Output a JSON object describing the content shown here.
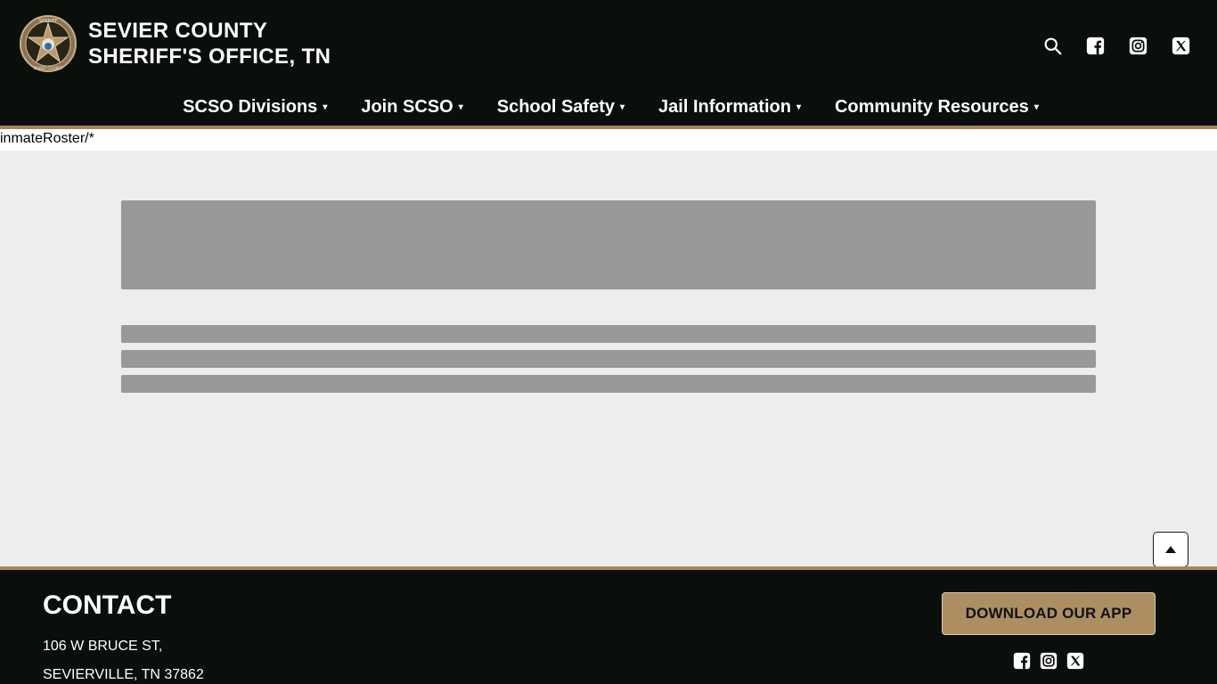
{
  "header": {
    "title_line1": "SEVIER COUNTY",
    "title_line2": "SHERIFF'S OFFICE, TN",
    "badge_text_top": "SHERIFF",
    "badge_text_bottom": "SEVIER COUNTY",
    "icons": [
      "search-icon",
      "facebook-icon",
      "instagram-icon",
      "x-icon"
    ]
  },
  "nav": {
    "items": [
      {
        "label": "SCSO Divisions",
        "caret": "▾"
      },
      {
        "label": "Join SCSO",
        "caret": "▾"
      },
      {
        "label": "School Safety",
        "caret": "▾"
      },
      {
        "label": "Jail Information",
        "caret": "▾"
      },
      {
        "label": "Community Resources",
        "caret": "▾"
      }
    ]
  },
  "path_text": "inmateRoster/*",
  "footer": {
    "contact_title": "CONTACT",
    "address_line1": "106 W BRUCE ST,",
    "address_line2": "SEVIERVILLE, TN 37862",
    "app_button": "DOWNLOAD OUR APP",
    "icons": [
      "facebook-icon",
      "instagram-icon",
      "x-icon"
    ]
  },
  "colors": {
    "dark": "#0a0f0b",
    "gold": "#a4865c",
    "button_gold": "#ad8e63",
    "skeleton": "#989898",
    "content_bg": "#ededed"
  }
}
